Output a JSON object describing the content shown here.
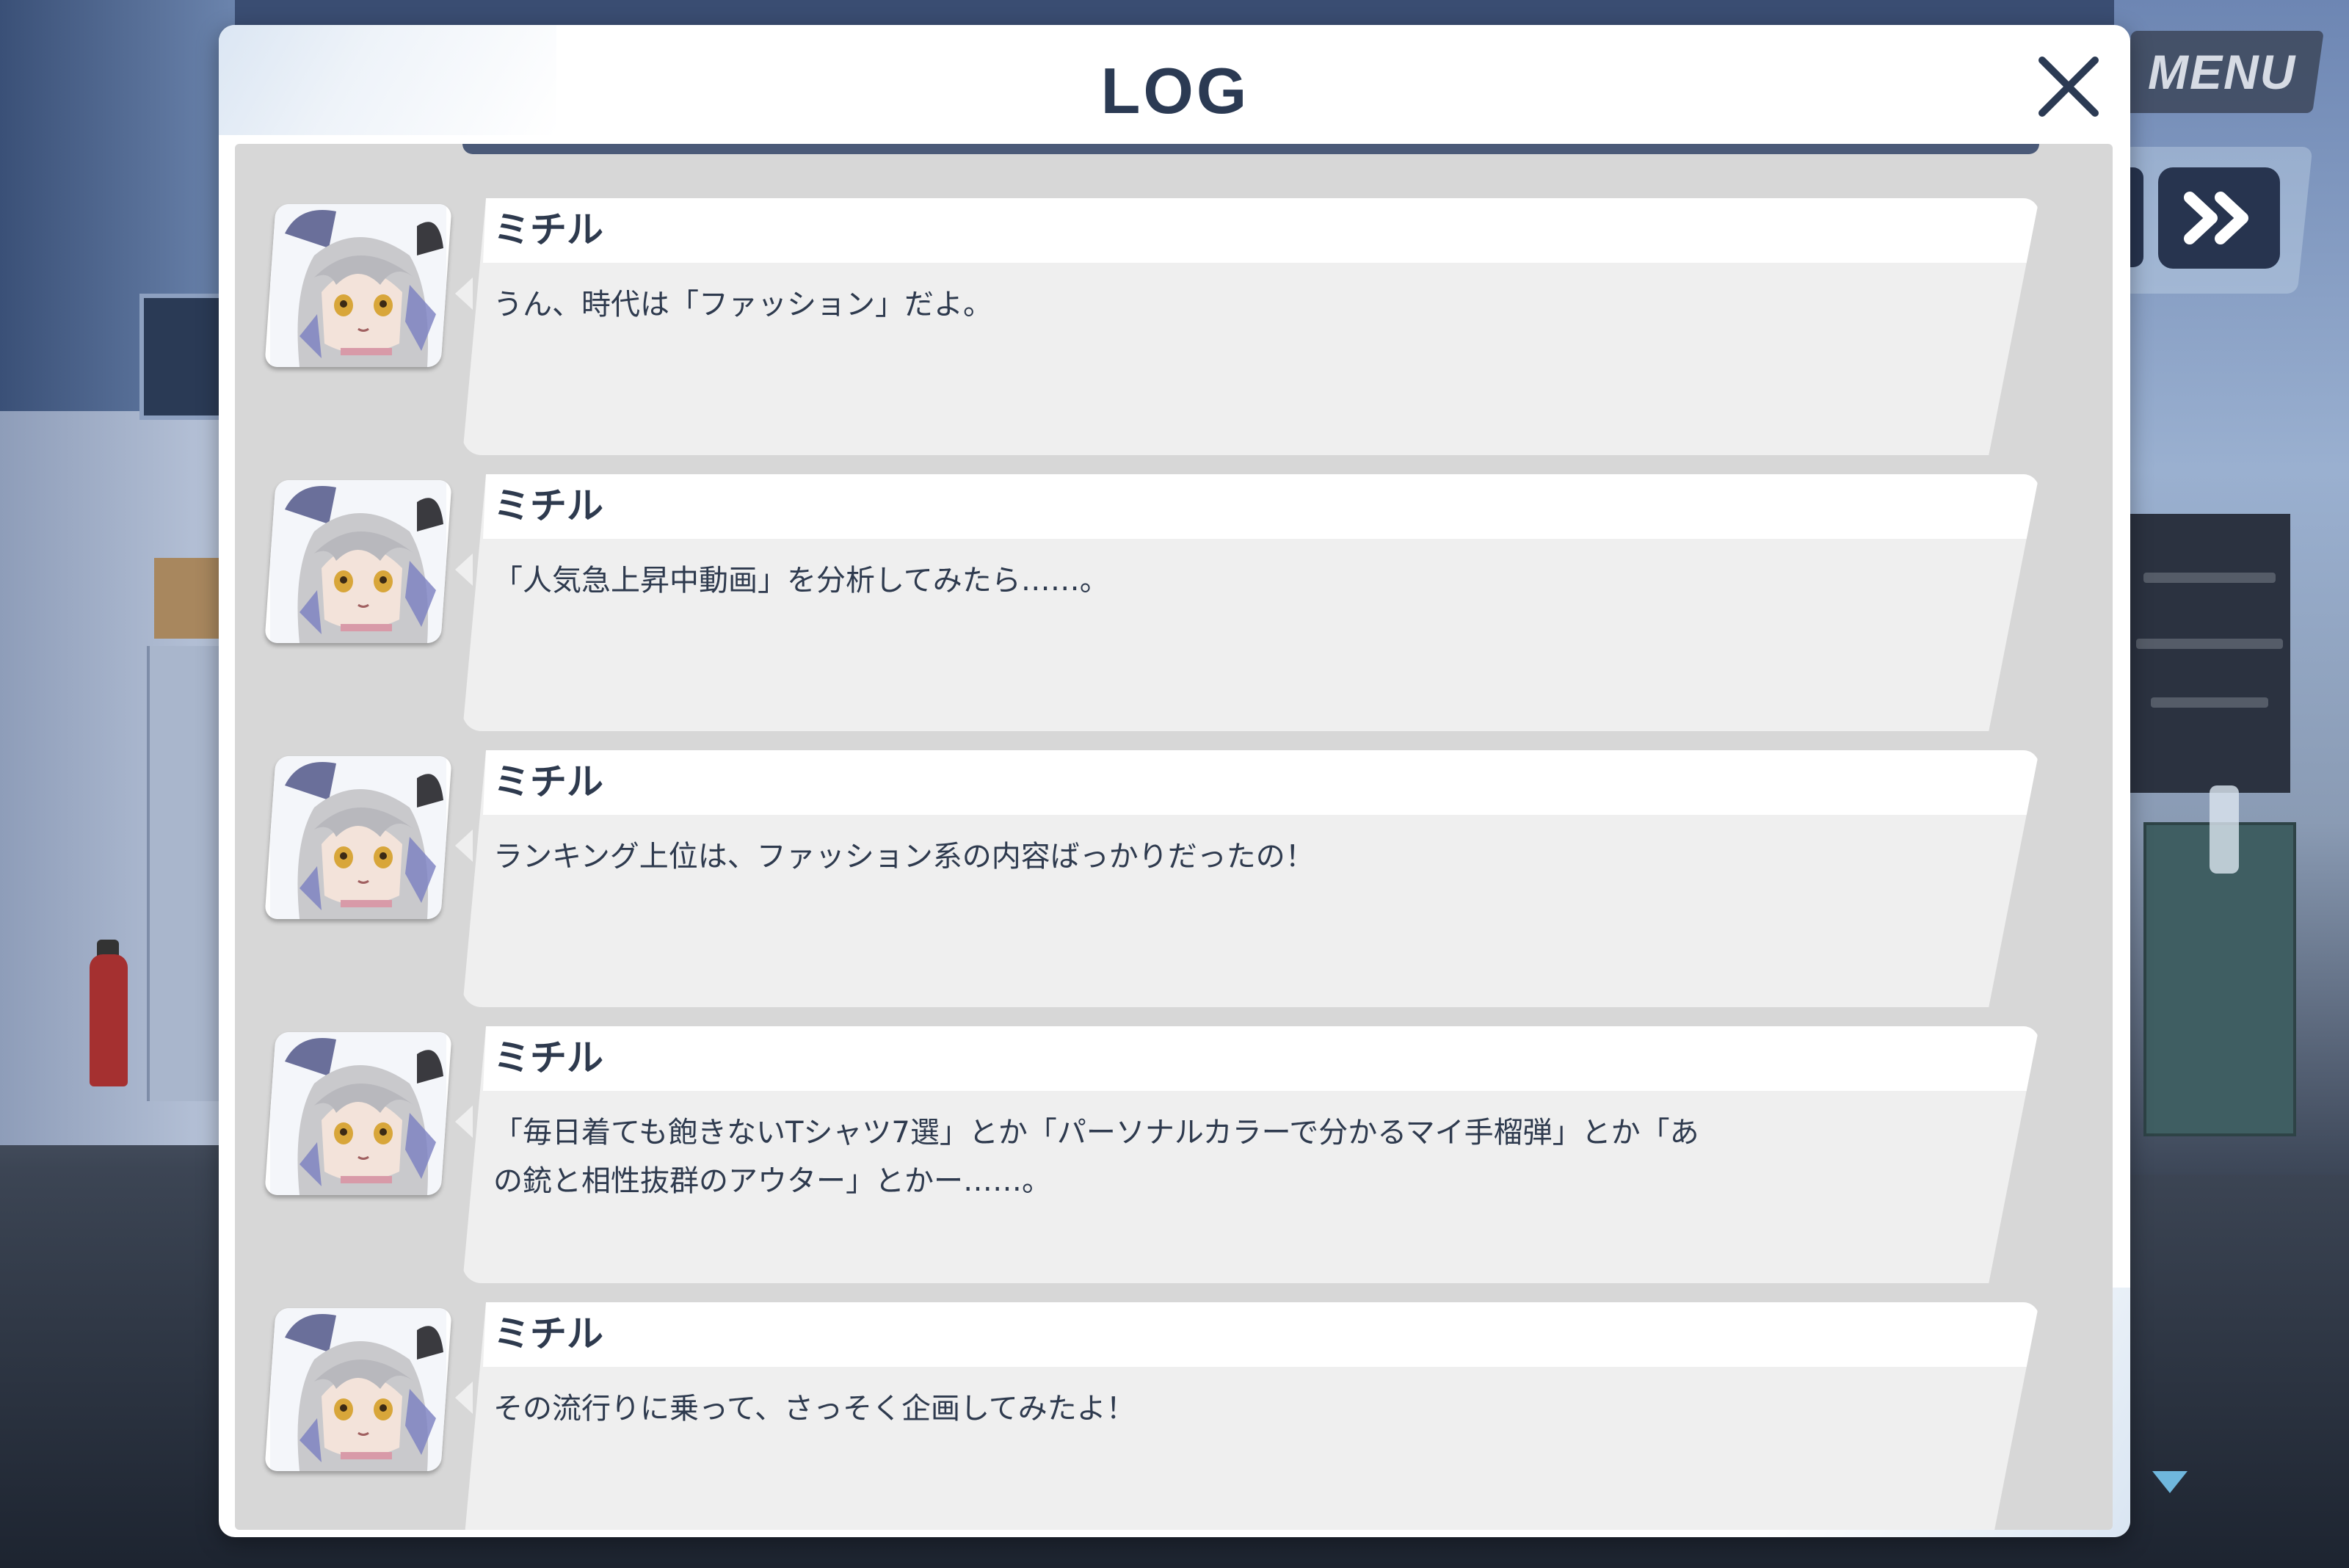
{
  "dialog": {
    "title": "LOG",
    "close_icon": "close-icon"
  },
  "controls": {
    "menu_label": "MENU",
    "fast_forward_icon": "fast-forward-icon",
    "scroll_icon": "scroll-down-arrow-icon"
  },
  "colors": {
    "title_underline": "#f2e23a",
    "title_text": "#2b3a53",
    "log_bg": "#d7d7d7",
    "bubble_bg": "#efefef",
    "speaker_bg": "#ffffff"
  },
  "log": {
    "entries": [
      {
        "speaker": "ミチル",
        "avatar_icon": "michiru-portrait",
        "text": "うん、時代は「ファッション」だよ。"
      },
      {
        "speaker": "ミチル",
        "avatar_icon": "michiru-portrait",
        "text": "「人気急上昇中動画」を分析してみたら……。"
      },
      {
        "speaker": "ミチル",
        "avatar_icon": "michiru-portrait",
        "text": "ランキング上位は、ファッション系の内容ばっかりだったの！"
      },
      {
        "speaker": "ミチル",
        "avatar_icon": "michiru-portrait",
        "text": "「毎日着ても飽きないTシャツ7選」とか「パーソナルカラーで分かるマイ手榴弾」とか「あ\nの銃と相性抜群のアウター」とかー……。"
      },
      {
        "speaker": "ミチル",
        "avatar_icon": "michiru-portrait",
        "text": "その流行りに乗って、さっそく企画してみたよ！"
      }
    ]
  }
}
